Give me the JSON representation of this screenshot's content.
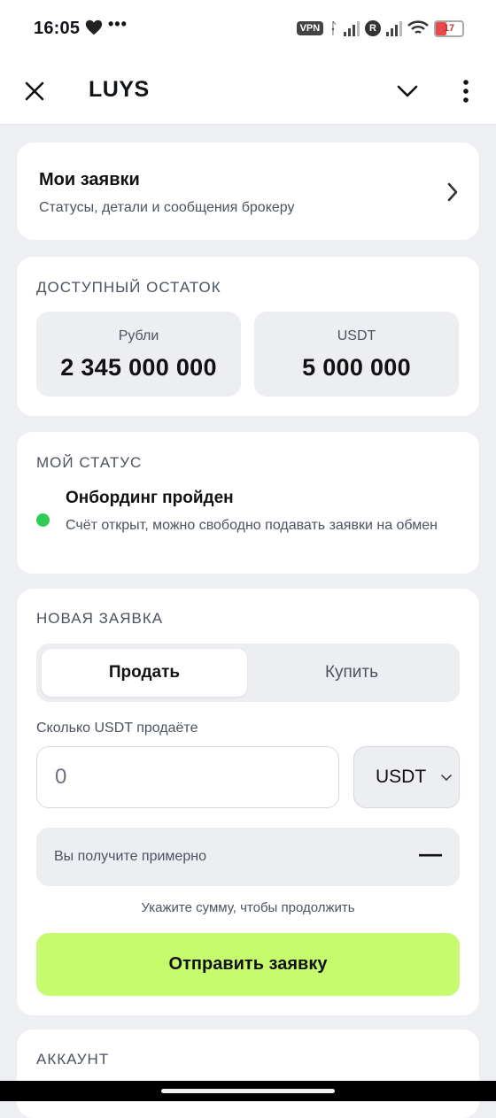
{
  "status_bar": {
    "time": "16:05",
    "notification_dots": "•••",
    "vpn": "VPN",
    "r_badge": "R",
    "battery": "17",
    "icons": [
      "heart-icon",
      "bluetooth-icon",
      "signal-icon",
      "wifi-icon",
      "battery-icon"
    ]
  },
  "header": {
    "title": "LUYS",
    "close_icon": "close-icon",
    "dropdown_icon": "chevron-down-icon",
    "menu_icon": "more-vertical-icon"
  },
  "my_orders": {
    "title": "Мои заявки",
    "subtitle": "Статусы, детали и сообщения брокеру"
  },
  "balance": {
    "title": "ДОСТУПНЫЙ ОСТАТОК",
    "rub_label": "Рубли",
    "rub_value": "2 345 000 000",
    "usdt_label": "USDT",
    "usdt_value": "5 000 000"
  },
  "status": {
    "title": "МОЙ СТАТУС",
    "state": "Онбординг пройден",
    "description": "Счёт открыт, можно свободно подавать заявки на обмен",
    "indicator_color": "#2ecc55"
  },
  "new_order": {
    "title": "НОВАЯ ЗАЯВКА",
    "tab_sell": "Продать",
    "tab_buy": "Купить",
    "active_tab": "Продать",
    "amount_label": "Сколько USDT продаёте",
    "amount_placeholder": "0",
    "amount_value": "",
    "currency": "USDT",
    "receive_label": "Вы получите примерно",
    "receive_value": "—",
    "hint": "Укажите сумму, чтобы продолжить",
    "submit_label": "Отправить заявку",
    "submit_color": "#c5fb6d"
  },
  "account": {
    "title": "АККАУНТ"
  }
}
